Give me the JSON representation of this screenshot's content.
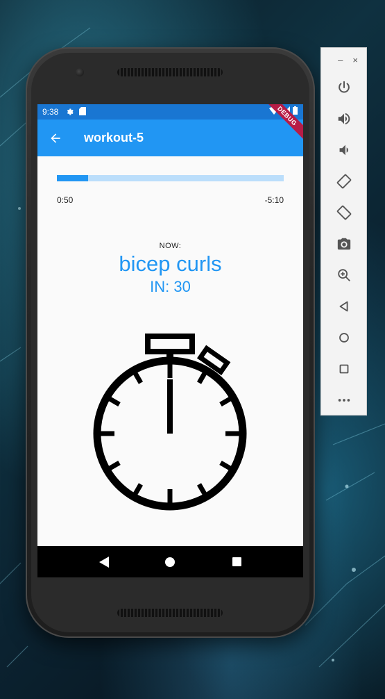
{
  "status_bar": {
    "time": "9:38"
  },
  "app_bar": {
    "title": "workout-5",
    "debug_banner": "DEBUG"
  },
  "progress": {
    "fraction": 0.138,
    "elapsed": "0:50",
    "remaining": "-5:10"
  },
  "exercise": {
    "now_label": "NOW:",
    "name": "bicep curls",
    "duration": "IN: 30"
  },
  "colors": {
    "accent": "#2196f3",
    "status_bar": "#1976d2",
    "progress_track": "#bbdefb"
  },
  "toolbar": {
    "minimize": "–",
    "close": "×",
    "buttons": [
      "power-icon",
      "volume-up-icon",
      "volume-down-icon",
      "rotate-left-icon",
      "rotate-right-icon",
      "camera-icon",
      "zoom-icon",
      "back-icon",
      "home-icon",
      "overview-icon",
      "more-icon"
    ]
  }
}
